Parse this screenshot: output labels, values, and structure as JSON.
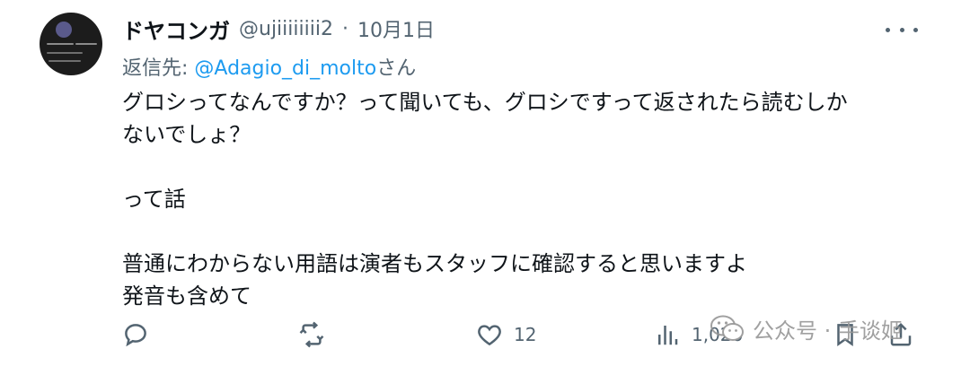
{
  "tweet": {
    "author": {
      "display_name": "ドヤコンガ",
      "handle": "@ujiiiiiiii2",
      "separator": "·",
      "date": "10月1日"
    },
    "reply_to": {
      "prefix": "返信先: ",
      "mention": "@Adagio_di_molto",
      "suffix": "さん"
    },
    "body": [
      "グロシってなんですか？って聞いても、グロシですって返されたら読むしか",
      "ないでしょ？",
      "",
      "って話",
      "",
      "普通にわからない用語は演者もスタッフに確認すると思いますよ",
      "発音も含めて"
    ],
    "actions": {
      "reply_icon": "reply-icon",
      "retweet_icon": "retweet-icon",
      "like_icon": "heart-icon",
      "like_count": "12",
      "views_icon": "views-icon",
      "views_count": "1,026",
      "bookmark_icon": "bookmark-icon",
      "share_icon": "share-icon",
      "more_icon": "more-horizontal-icon"
    }
  },
  "watermark": {
    "icon": "wechat-icon",
    "text": "公众号 · 手谈姬"
  },
  "colors": {
    "text_primary": "#0f1419",
    "text_secondary": "#536471",
    "link": "#1d9bf0",
    "background": "#ffffff"
  }
}
